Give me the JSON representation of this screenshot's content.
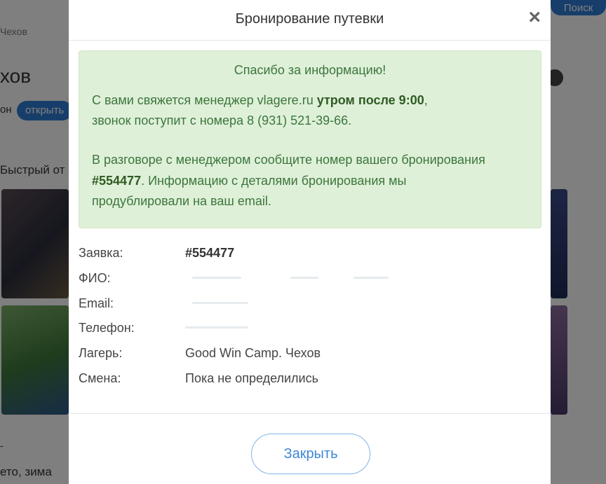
{
  "background": {
    "breadcrumb": "Чехов",
    "title": "хов",
    "badge_prefix": "он",
    "badge": "открыть",
    "fast_text": "Быстрый от",
    "season_text": "ето, зима",
    "dash": "-",
    "search_label": "Поиск"
  },
  "modal": {
    "title": "Бронирование путевки",
    "close_icon": "×",
    "alert": {
      "title": "Спасибо за информацию!",
      "line1_text": "С вами свяжется менеджер vlagere.ru ",
      "line1_bold": "утром после 9:00",
      "line1_end": ",",
      "line2": "звонок поступит с номера 8 (931) 521-39-66.",
      "line3": "В разговоре с менеджером сообщите номер вашего бронирования",
      "line4_bold": "#554477",
      "line4_text": ". Информацию с деталями бронирования мы",
      "line5": "продублировали на ваш email."
    },
    "details": {
      "order_label": "Заявка:",
      "order_value": "#554477",
      "name_label": "ФИО:",
      "email_label": "Email:",
      "phone_label": "Телефон:",
      "camp_label": "Лагерь:",
      "camp_value": "Good Win Camp. Чехов",
      "shift_label": "Смена:",
      "shift_value": "Пока не определились"
    },
    "close_button": "Закрыть"
  },
  "colors": {
    "alert_bg": "#dff0d8",
    "alert_text": "#3c763d",
    "accent": "#3c87d6"
  }
}
